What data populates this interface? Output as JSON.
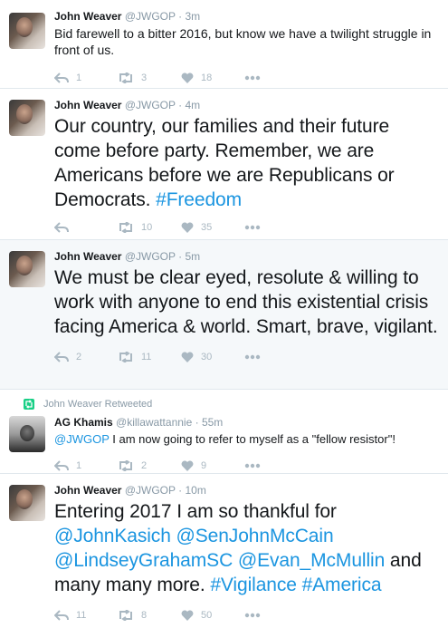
{
  "tweets": [
    {
      "name": "John Weaver",
      "handle": "@JWGOP",
      "time": "3m",
      "text": "Bid farewell to a bitter 2016, but know we have a twilight struggle in front of us.",
      "replies": "1",
      "retweets": "3",
      "likes": "18"
    },
    {
      "name": "John Weaver",
      "handle": "@JWGOP",
      "time": "4m",
      "text": "Our country, our families and their future come before party. Remember, we are Americans before we are Republicans or Democrats.",
      "hashtag": "#Freedom",
      "replies": "",
      "retweets": "10",
      "likes": "35"
    },
    {
      "name": "John Weaver",
      "handle": "@JWGOP",
      "time": "5m",
      "text": "We must be clear eyed, resolute & willing to work with anyone to end this existential crisis facing America & world. Smart, brave, vigilant.",
      "replies": "2",
      "retweets": "11",
      "likes": "30"
    },
    {
      "retweet_context": "John Weaver Retweeted",
      "name": "AG Khamis",
      "handle": "@killawattannie",
      "time": "55m",
      "mention": "@JWGOP",
      "text": "I am now going to refer to myself as a \"fellow resistor\"!",
      "replies": "1",
      "retweets": "2",
      "likes": "9"
    },
    {
      "name": "John Weaver",
      "handle": "@JWGOP",
      "time": "10m",
      "text_before": "Entering 2017 I am so thankful for",
      "mentions": "@JohnKasich @SenJohnMcCain @LindseyGrahamSC @Evan_McMullin",
      "text_middle": "and many many more.",
      "hashtags": "#Vigilance #America",
      "replies": "11",
      "retweets": "8",
      "likes": "50"
    }
  ],
  "sep": "·",
  "icons": {
    "reply": "reply-icon",
    "retweet": "retweet-icon",
    "like": "heart-icon",
    "more": "more-icon"
  },
  "colors": {
    "link": "#1b95e0",
    "retweet_badge": "#19cf86",
    "muted": "#8899a6",
    "shaded_bg": "#f5f8fa"
  }
}
